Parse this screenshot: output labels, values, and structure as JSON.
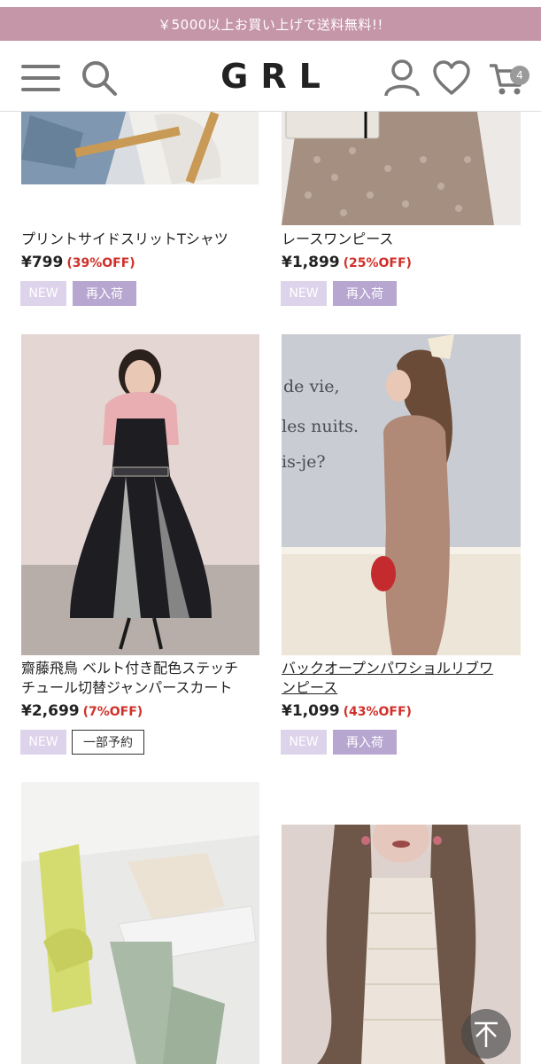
{
  "banner": {
    "text": "￥5000以上お買い上げで送料無料!!"
  },
  "header": {
    "logo": "GRL",
    "cart_count": "4",
    "icons": [
      "menu-icon",
      "search-icon",
      "user-icon",
      "heart-icon",
      "cart-icon"
    ]
  },
  "products": [
    {
      "name": "プリントサイドスリットTシャツ",
      "price": "¥799",
      "discount": "(39%OFF)",
      "tags": [
        "NEW",
        "再入荷"
      ]
    },
    {
      "name": "レースワンピース",
      "price": "¥1,899",
      "discount": "(25%OFF)",
      "tags": [
        "NEW",
        "再入荷"
      ]
    },
    {
      "name": "齋藤飛鳥 ベルト付き配色ステッチチュール切替ジャンパースカート",
      "name_line1": "齋藤飛鳥 ベルト付き配色ステッチ",
      "name_line2": "チュール切替ジャンパースカート",
      "price": "¥2,699",
      "discount": "(7%OFF)",
      "tags": [
        "NEW",
        "一部予約"
      ]
    },
    {
      "name": "バックオープンパワショルリブワンピース",
      "name_line1": "バックオープンパワショルリブワ",
      "name_line2": "ンピース",
      "price": "¥1,099",
      "discount": "(43%OFF)",
      "tags": [
        "NEW",
        "再入荷"
      ]
    },
    {
      "name": "",
      "price": "",
      "discount": "",
      "tags": []
    },
    {
      "name": "",
      "price": "",
      "discount": "",
      "tags": []
    }
  ],
  "photo_text": {
    "wall_line1": "de vie,",
    "wall_line2": "les nuits.",
    "wall_line3": "is-je?"
  },
  "colors": {
    "banner": "#c596a7",
    "discount": "#d0302a",
    "tag_new": "#ddd3ea",
    "tag_restock": "#b7a6cf"
  }
}
